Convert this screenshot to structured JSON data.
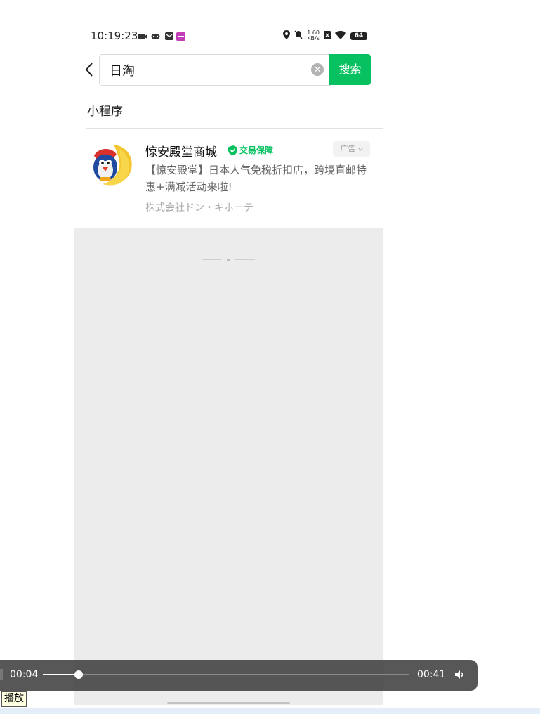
{
  "status_bar": {
    "time": "10:19:23",
    "net_speed_value": "1.60",
    "net_speed_unit": "KB/s",
    "battery": "64"
  },
  "search": {
    "query": "日淘",
    "button_label": "搜索"
  },
  "section": {
    "title": "小程序"
  },
  "result": {
    "title": "惊安殿堂商城",
    "badge": "交易保障",
    "ad_label": "广告",
    "description": "【惊安殿堂】日本人气免税折扣店，跨境直邮特惠+满减活动来啦!",
    "company": "株式会社ドン・キホーテ"
  },
  "video_controls": {
    "current_time": "00:04",
    "total_time": "00:41",
    "progress_fraction": 0.098
  },
  "tooltip": {
    "text": "播放"
  },
  "colors": {
    "accent": "#07c160",
    "panel_bg": "#ececec"
  },
  "icons": [
    "back-chevron-icon",
    "clear-icon",
    "shield-check-icon",
    "chevron-down-icon",
    "volume-icon",
    "location-icon",
    "mute-icon",
    "wifi-icon",
    "video-icon"
  ]
}
